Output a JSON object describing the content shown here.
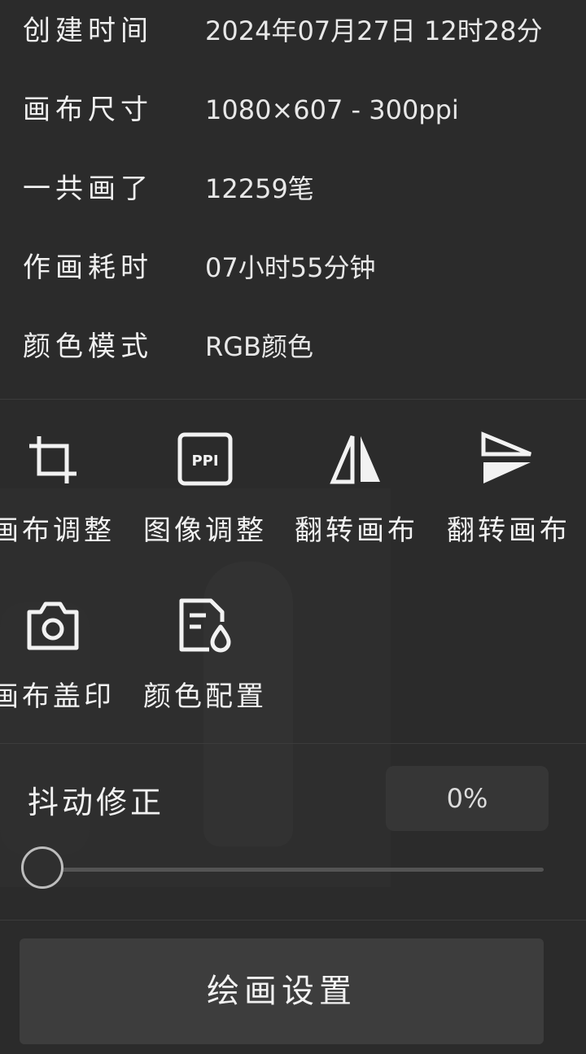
{
  "info": [
    {
      "label": "创建时间",
      "value": "2024年07月27日 12时28分"
    },
    {
      "label": "画布尺寸",
      "value": "1080×607 - 300ppi"
    },
    {
      "label": "一共画了",
      "value": "12259笔"
    },
    {
      "label": "作画耗时",
      "value": "07小时55分钟"
    },
    {
      "label": "颜色模式",
      "value": "RGB颜色"
    }
  ],
  "tools": [
    {
      "label": "画布调整",
      "icon": "crop-icon"
    },
    {
      "label": "图像调整",
      "icon": "ppi-icon"
    },
    {
      "label": "翻转画布",
      "icon": "flip-horizontal-icon"
    },
    {
      "label": "翻转画布",
      "icon": "flip-vertical-icon"
    },
    {
      "label": "画布盖印",
      "icon": "camera-icon"
    },
    {
      "label": "颜色配置",
      "icon": "color-profile-icon"
    }
  ],
  "ppi_icon_text": "PPI",
  "jitter": {
    "label": "抖动修正",
    "value": "0%",
    "level": 0
  },
  "settings_button": "绘画设置",
  "colors": {
    "background": "#2b2b2b",
    "button": "#3d3d3d",
    "text": "#f2f2f2"
  }
}
